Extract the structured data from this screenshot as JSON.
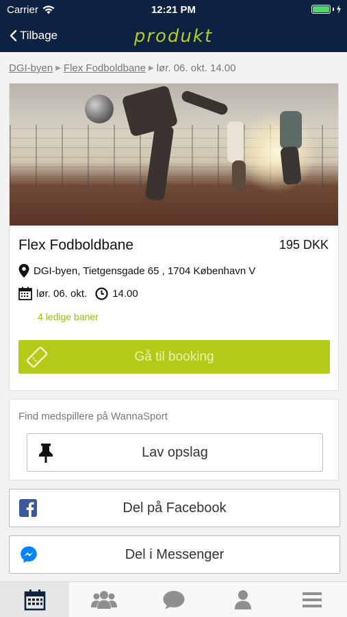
{
  "status_bar": {
    "carrier": "Carrier",
    "time": "12:21 PM"
  },
  "nav": {
    "back_label": "Tilbage",
    "title": "produkt"
  },
  "breadcrumb": {
    "items": [
      "DGI-byen",
      "Flex Fodboldbane",
      "lør. 06. okt. 14.00"
    ]
  },
  "product": {
    "name": "Flex Fodboldbane",
    "price": "195 DKK",
    "address": "DGI-byen, Tietgensgade 65 , 1704 København V",
    "date": "lør. 06. okt.",
    "time": "14.00",
    "availability": "4 ledige baner",
    "book_label": "Gå til booking"
  },
  "wannasport": {
    "label": "Find medspillere på WannaSport",
    "button_label": "Lav opslag"
  },
  "share": {
    "facebook_label": "Del på Facebook",
    "messenger_label": "Del i Messenger"
  },
  "colors": {
    "header_bg": "#0d2240",
    "accent": "#b3cb18",
    "facebook": "#3b5998",
    "messenger": "#0084ff"
  },
  "tabbar": {
    "items": [
      {
        "icon": "calendar-icon",
        "active": true
      },
      {
        "icon": "group-icon",
        "active": false
      },
      {
        "icon": "chat-icon",
        "active": false
      },
      {
        "icon": "profile-icon",
        "active": false
      },
      {
        "icon": "menu-icon",
        "active": false
      }
    ]
  }
}
